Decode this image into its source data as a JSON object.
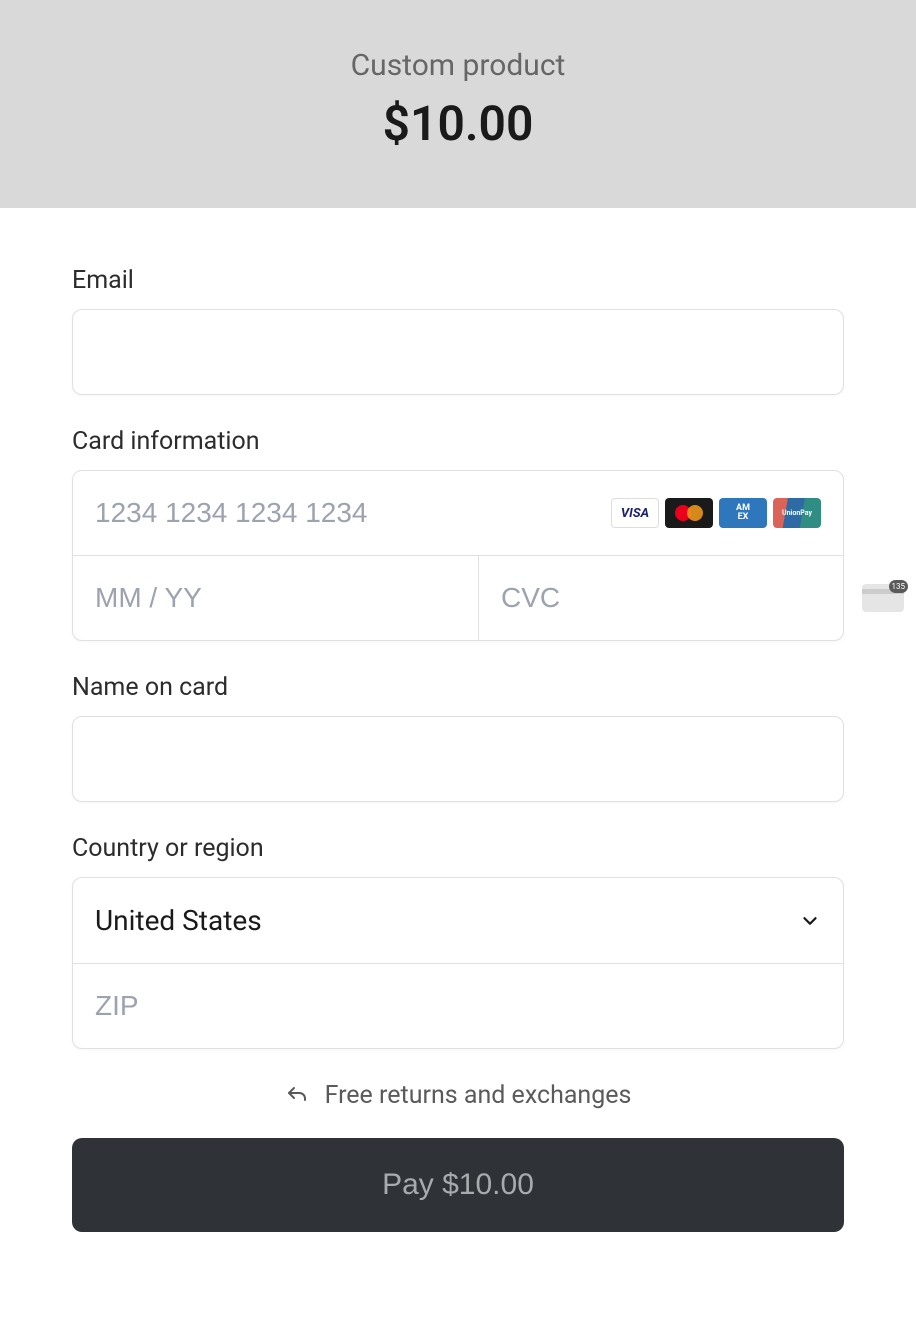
{
  "header": {
    "product_name": "Custom product",
    "price": "$10.00"
  },
  "fields": {
    "email": {
      "label": "Email",
      "value": "",
      "placeholder": ""
    },
    "card": {
      "label": "Card information",
      "number_placeholder": "1234 1234 1234 1234",
      "number_value": "",
      "expiry_placeholder": "MM / YY",
      "expiry_value": "",
      "cvc_placeholder": "CVC",
      "cvc_value": "",
      "cvc_badge": "135",
      "brands": [
        "visa",
        "mastercard",
        "amex",
        "unionpay"
      ]
    },
    "name": {
      "label": "Name on card",
      "value": "",
      "placeholder": ""
    },
    "country": {
      "label": "Country or region",
      "selected": "United States",
      "zip_placeholder": "ZIP",
      "zip_value": ""
    }
  },
  "returns": {
    "text": "Free returns and exchanges"
  },
  "pay_button": {
    "label": "Pay $10.00"
  }
}
